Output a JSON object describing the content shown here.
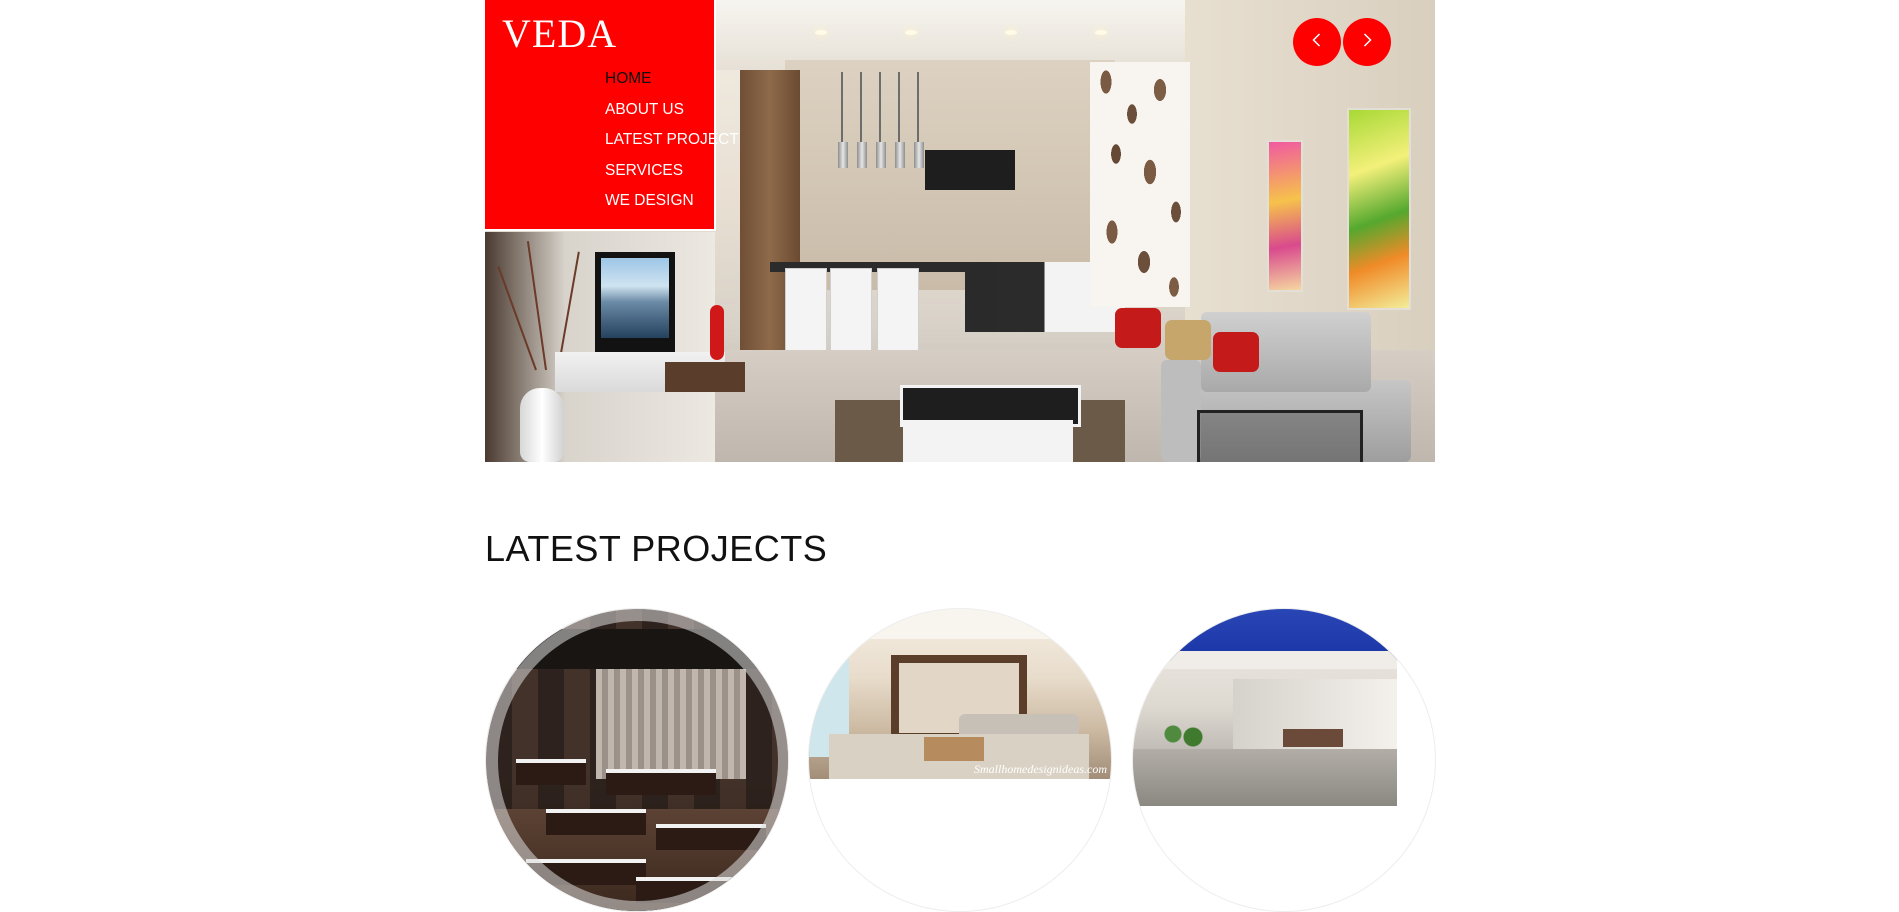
{
  "brand": {
    "name": "VEDA",
    "accent_color": "#ff0000"
  },
  "nav": {
    "items": [
      {
        "label": "HOME",
        "active": true
      },
      {
        "label": "ABOUT US",
        "active": false
      },
      {
        "label": "LATEST PROJECT",
        "active": false
      },
      {
        "label": "SERVICES",
        "active": false
      },
      {
        "label": "WE DESIGN",
        "active": false
      }
    ]
  },
  "slider": {
    "prev_icon": "chevron-left-icon",
    "next_icon": "chevron-right-icon"
  },
  "projects": {
    "title": "LATEST PROJECTS",
    "items": [
      {
        "image": "restaurant-interior"
      },
      {
        "image": "living-room-interior",
        "watermark": "Smallhomedesignideas.com"
      },
      {
        "image": "patio-interior"
      }
    ]
  }
}
